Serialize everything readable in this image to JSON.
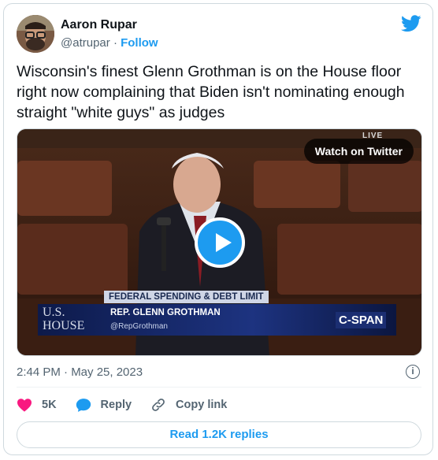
{
  "author": {
    "name": "Aaron Rupar",
    "handle": "@atrupar",
    "separator": "·",
    "follow_label": "Follow"
  },
  "tweet": {
    "text": "Wisconsin's finest Glenn Grothman is on the House floor right now complaining that Biden isn't nominating enough straight \"white guys\" as judges"
  },
  "media": {
    "watch_label": "Watch on Twitter",
    "live_text": "LIVE",
    "banner_title": "FEDERAL SPENDING & DEBT LIMIT",
    "lower_name": "REP. GLENN GROTHMAN",
    "lower_handle": "@RepGrothman",
    "network_line1": "U.S.",
    "network_line2": "HOUSE",
    "channel": "C-SPAN"
  },
  "timestamp": "2:44 PM · May 25, 2023",
  "info_icon": "i",
  "actions": {
    "likes": "5K",
    "reply_label": "Reply",
    "copy_label": "Copy link"
  },
  "read_replies_label": "Read 1.2K replies",
  "colors": {
    "accent": "#1d9bf0",
    "like": "#f91880",
    "text": "#0f1419",
    "muted": "#536471"
  }
}
